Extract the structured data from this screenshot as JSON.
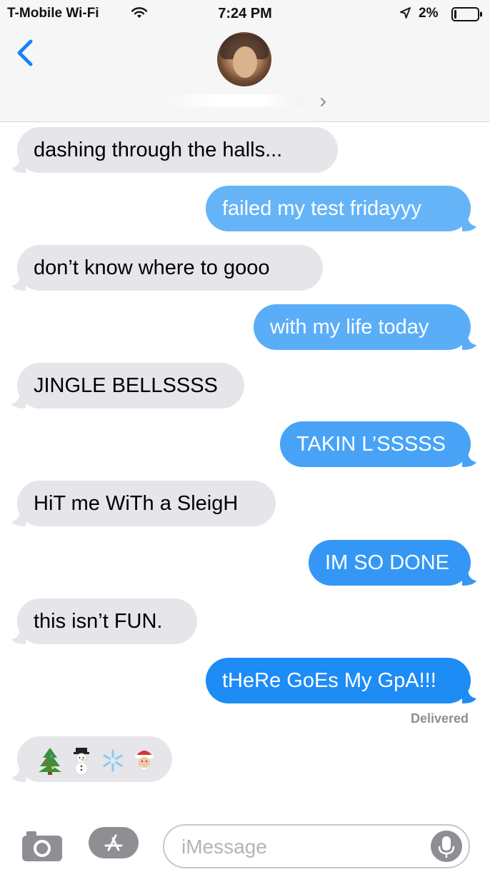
{
  "status_bar": {
    "carrier": "T-Mobile Wi-Fi",
    "time": "7:24 PM",
    "battery": "2%"
  },
  "icons": {
    "wifi": "wifi-icon",
    "location": "location-arrow-icon",
    "battery": "battery-icon",
    "back": "chevron-left-icon",
    "chevron": "chevron-right-icon",
    "camera": "camera-icon",
    "appstore": "app-store-icon",
    "mic": "microphone-icon"
  },
  "colors": {
    "received_bubble": "#e5e5ea",
    "sent_bubble": "#1e8cf5",
    "accent": "#1a82fb"
  },
  "messages": [
    {
      "from": "them",
      "text": "dashing through the halls..."
    },
    {
      "from": "me",
      "text": "failed my test fridayyy"
    },
    {
      "from": "them",
      "text": "don’t know where to gooo"
    },
    {
      "from": "me",
      "text": "with my life today"
    },
    {
      "from": "them",
      "text": "JINGLE BELLSSSS"
    },
    {
      "from": "me",
      "text": "TAKIN L’SSSSS"
    },
    {
      "from": "them",
      "text": "HiT me WiTh a SleigH"
    },
    {
      "from": "me",
      "text": "IM SO DONE"
    },
    {
      "from": "them",
      "text": "this isn’t FUN."
    },
    {
      "from": "me",
      "text": "tHeRe GoEs My GpA!!!"
    }
  ],
  "delivered_label": "Delivered",
  "emoji_message": [
    "christmas-tree-emoji",
    "snowman-emoji",
    "snowflake-emoji",
    "santa-emoji"
  ],
  "composer": {
    "placeholder": "iMessage"
  }
}
